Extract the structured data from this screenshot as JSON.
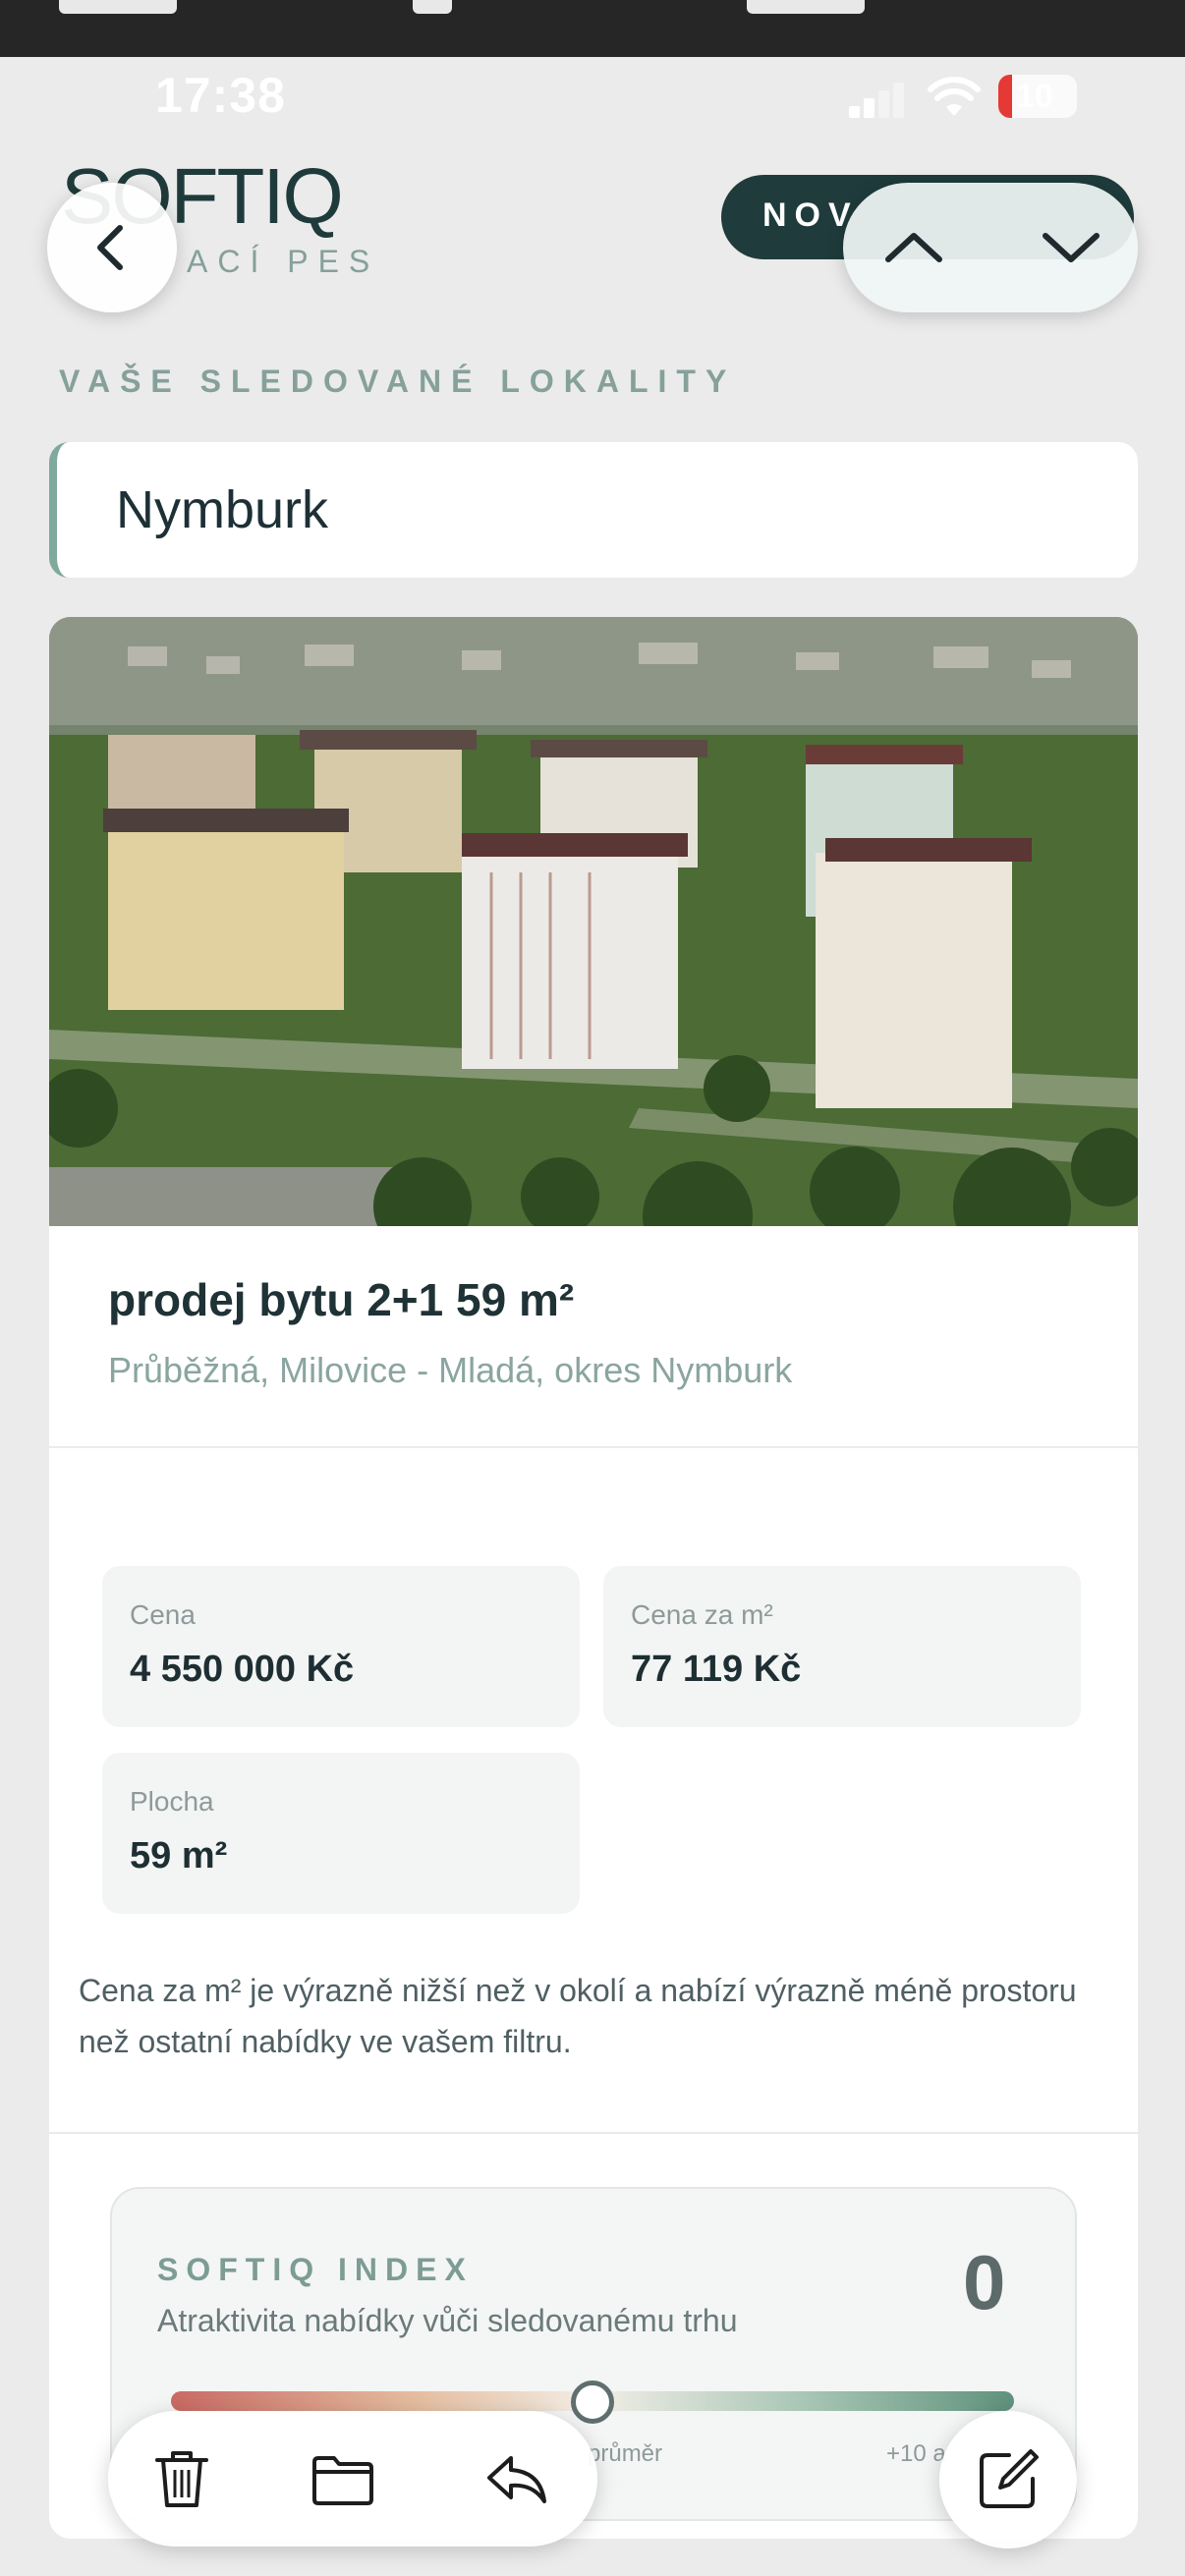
{
  "status_bar": {
    "time": "17:38",
    "battery": "10",
    "icons": [
      "signal-icon",
      "wifi-icon",
      "battery-icon"
    ]
  },
  "header": {
    "logo": "SOFTIQ",
    "tagline": "ACÍ PES",
    "new_button_label": "NOV"
  },
  "nav": {
    "back_icon": "chevron-left-icon",
    "up_icon": "chevron-up-icon",
    "down_icon": "chevron-down-icon"
  },
  "section_title": "VAŠE SLEDOVANÉ LOKALITY",
  "location": {
    "name": "Nymburk"
  },
  "listing": {
    "title": "prodej bytu 2+1 59 m²",
    "address": "Průběžná, Milovice - Mladá, okres Nymburk",
    "stats": [
      {
        "label": "Cena",
        "value": "4 550 000 Kč"
      },
      {
        "label": "Cena za m²",
        "value": "77 119 Kč"
      },
      {
        "label": "Plocha",
        "value": "59 m²"
      }
    ],
    "description": "Cena za m² je výrazně nižší než v okolí a nabízí výrazně méně prostoru než ostatní nabídky ve vašem filtru."
  },
  "index": {
    "title": "SOFTIQ INDEX",
    "subtitle": "Atraktivita nabídky vůči sledovanému trhu",
    "value": "0",
    "level_fraction": 0.5,
    "mid_label": "průměr",
    "right_label": "+10 a"
  },
  "toolbar": {
    "icons": [
      "trash-icon",
      "folder-icon",
      "reply-icon"
    ],
    "compose_icon": "compose-icon"
  },
  "colors": {
    "accent_dark": "#1f3b3b",
    "accent_muted": "#86a09a",
    "location_border": "#7fa99c",
    "battery_low": "#e53935"
  }
}
